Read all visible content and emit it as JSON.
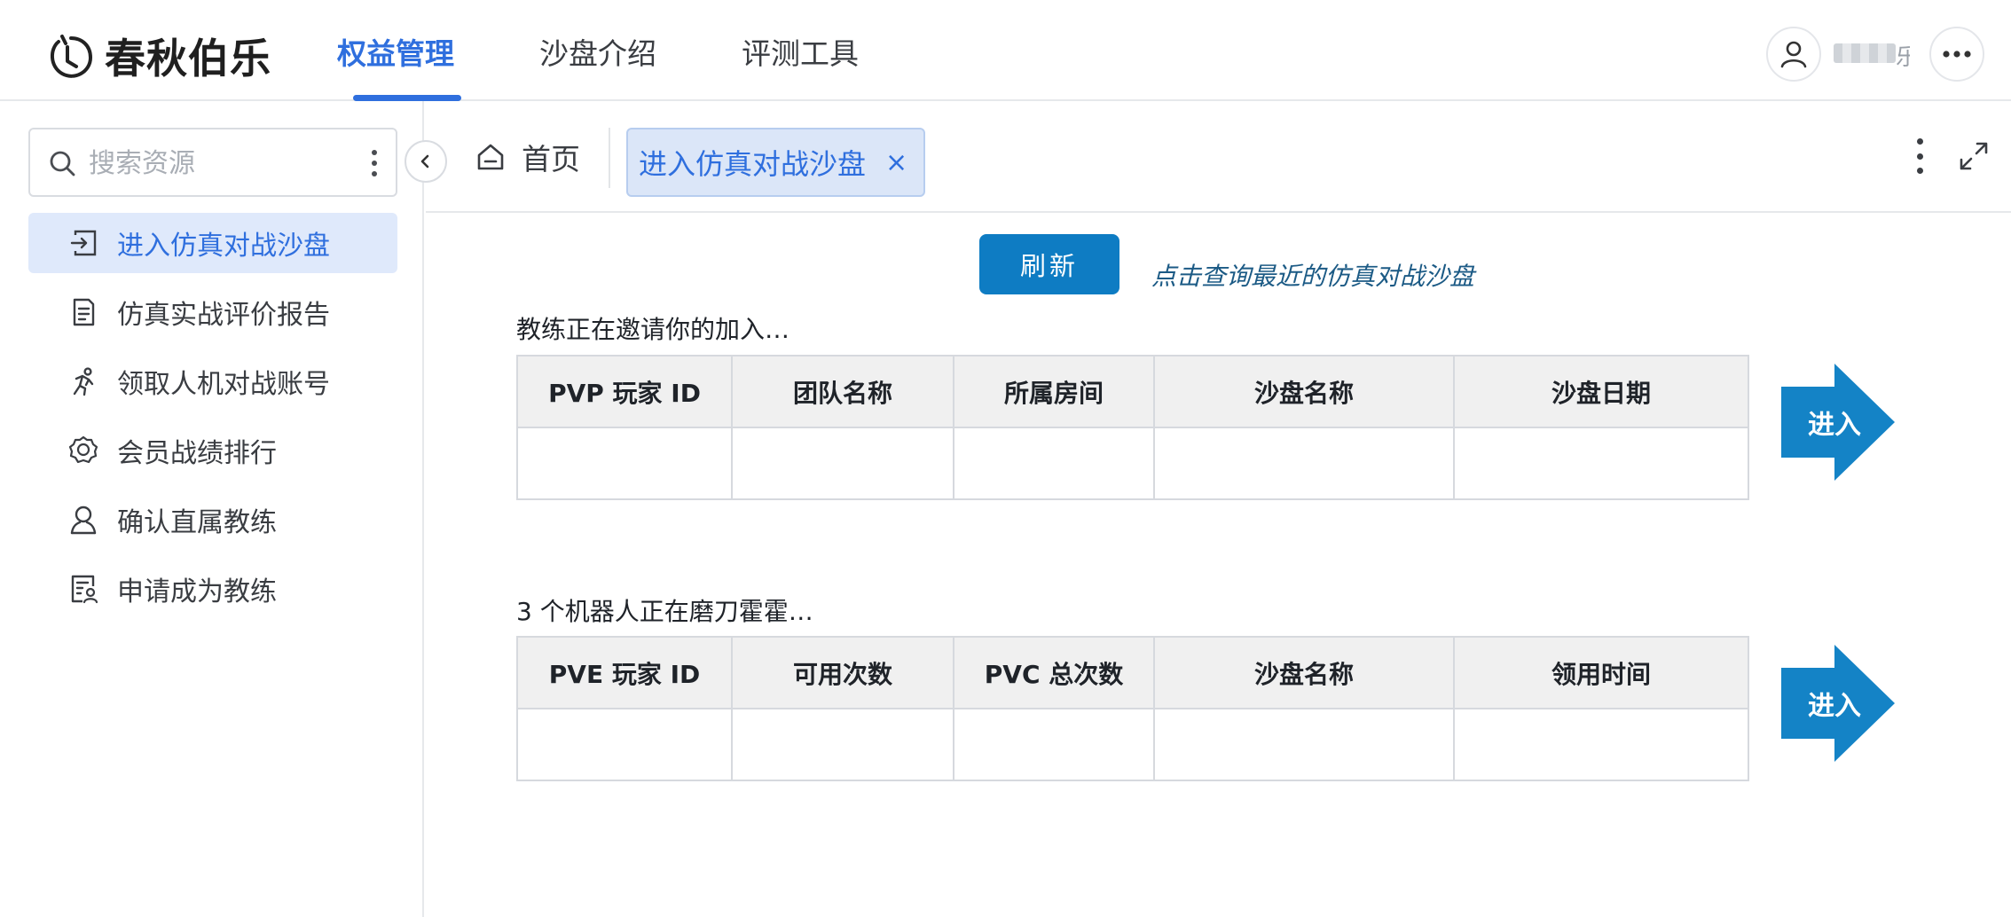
{
  "header": {
    "logo_text": "春秋伯乐",
    "nav": [
      {
        "label": "权益管理",
        "active": true
      },
      {
        "label": "沙盘介绍",
        "active": false
      },
      {
        "label": "评测工具",
        "active": false
      }
    ],
    "username_tail": "乐"
  },
  "sidebar": {
    "search_placeholder": "搜索资源",
    "items": [
      {
        "label": "进入仿真对战沙盘",
        "icon": "enter-icon",
        "active": true
      },
      {
        "label": "仿真实战评价报告",
        "icon": "report-icon",
        "active": false
      },
      {
        "label": "领取人机对战账号",
        "icon": "runner-icon",
        "active": false
      },
      {
        "label": "会员战绩排行",
        "icon": "award-icon",
        "active": false
      },
      {
        "label": "确认直属教练",
        "icon": "user-icon",
        "active": false
      },
      {
        "label": "申请成为教练",
        "icon": "apply-icon",
        "active": false
      }
    ]
  },
  "tabs": {
    "home_label": "首页",
    "active_label": "进入仿真对战沙盘",
    "close_glyph": "×"
  },
  "main": {
    "refresh_label": "刷新",
    "refresh_hint": "点击查询最近的仿真对战沙盘",
    "section1": {
      "title": "教练正在邀请你的加入…",
      "columns": [
        "PVP 玩家 ID",
        "团队名称",
        "所属房间",
        "沙盘名称",
        "沙盘日期"
      ],
      "enter_label": "进入"
    },
    "section2": {
      "title": "3 个机器人正在磨刀霍霍…",
      "columns": [
        "PVE 玩家 ID",
        "可用次数",
        "PVC 总次数",
        "沙盘名称",
        "领用时间"
      ],
      "enter_label": "进入"
    }
  },
  "colors": {
    "accent": "#2f6fde",
    "button": "#0e7cc3",
    "arrow": "#1483c6",
    "active_bg": "#dfe9fb"
  }
}
